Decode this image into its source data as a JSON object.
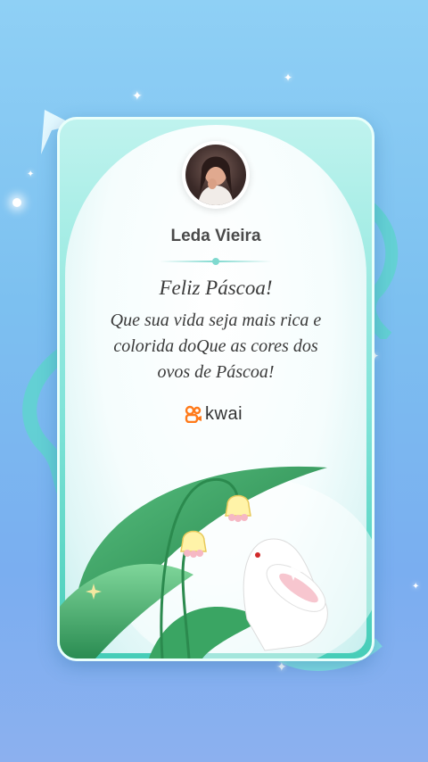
{
  "card": {
    "user_name": "Leda Vieira",
    "greeting": "Feliz Páscoa!",
    "message_lines": [
      "Que sua vida seja mais rica e",
      "colorida doQue as cores dos",
      "ovos de Páscoa!"
    ],
    "brand": "kwai"
  },
  "colors": {
    "background": "#7cc0f0",
    "card_teal": "#46cdb8",
    "brand_orange": "#ff7a1a",
    "leaf_green": "#2e9a58"
  },
  "icons": [
    "sparkle-icon",
    "kwai-logo-icon"
  ]
}
